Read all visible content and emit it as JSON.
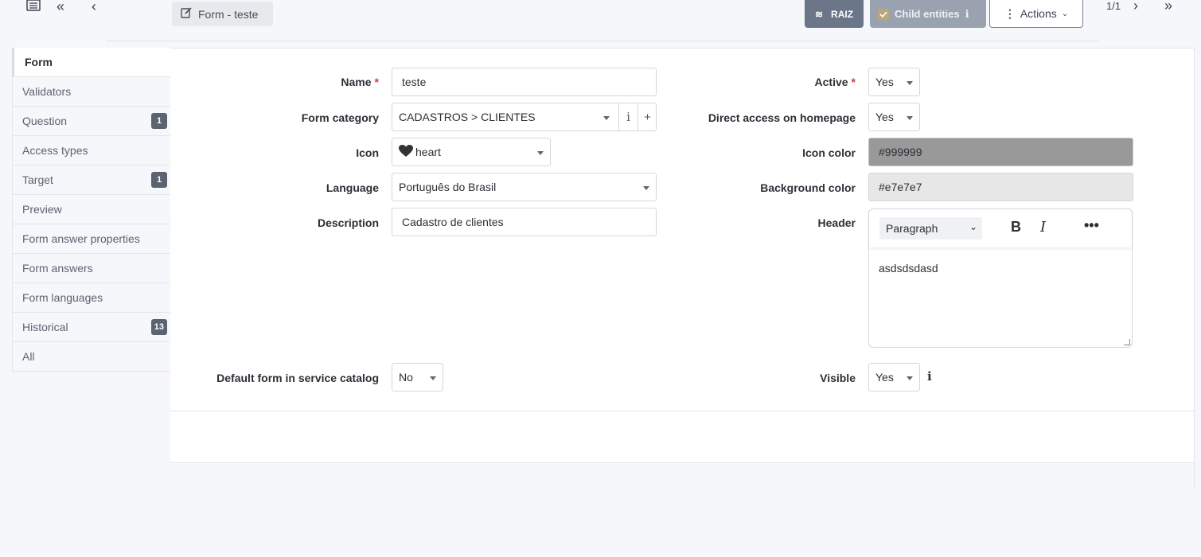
{
  "header": {
    "breadcrumb": "Form - teste",
    "raiz_label": "RAIZ",
    "child_entities_label": "Child entities",
    "actions_label": "Actions",
    "pager": "1/1"
  },
  "sidebar": {
    "items": [
      {
        "label": "Form",
        "badge": ""
      },
      {
        "label": "Validators",
        "badge": ""
      },
      {
        "label": "Question",
        "badge": "1"
      },
      {
        "label": "Access types",
        "badge": ""
      },
      {
        "label": "Target",
        "badge": "1"
      },
      {
        "label": "Preview",
        "badge": ""
      },
      {
        "label": "Form answer properties",
        "badge": ""
      },
      {
        "label": "Form answers",
        "badge": ""
      },
      {
        "label": "Form languages",
        "badge": ""
      },
      {
        "label": "Historical",
        "badge": "13"
      },
      {
        "label": "All",
        "badge": ""
      }
    ]
  },
  "form": {
    "name_label": "Name",
    "name_value": "teste",
    "category_label": "Form category",
    "category_value": "CADASTROS > CLIENTES",
    "icon_label": "Icon",
    "icon_value": "heart",
    "language_label": "Language",
    "language_value": "Português do Brasil",
    "description_label": "Description",
    "description_value": "Cadastro de clientes",
    "default_label": "Default form in service catalog",
    "default_value": "No",
    "active_label": "Active",
    "active_value": "Yes",
    "direct_label": "Direct access on homepage",
    "direct_value": "Yes",
    "icon_color_label": "Icon color",
    "icon_color_value": "#999999",
    "bg_color_label": "Background color",
    "bg_color_value": "#e7e7e7",
    "header_label": "Header",
    "header_paragraph": "Paragraph",
    "header_content": "asdsdsdasd",
    "visible_label": "Visible",
    "visible_value": "Yes"
  },
  "colors": {
    "icon_color": "#999999",
    "background_color": "#e7e7e7"
  }
}
